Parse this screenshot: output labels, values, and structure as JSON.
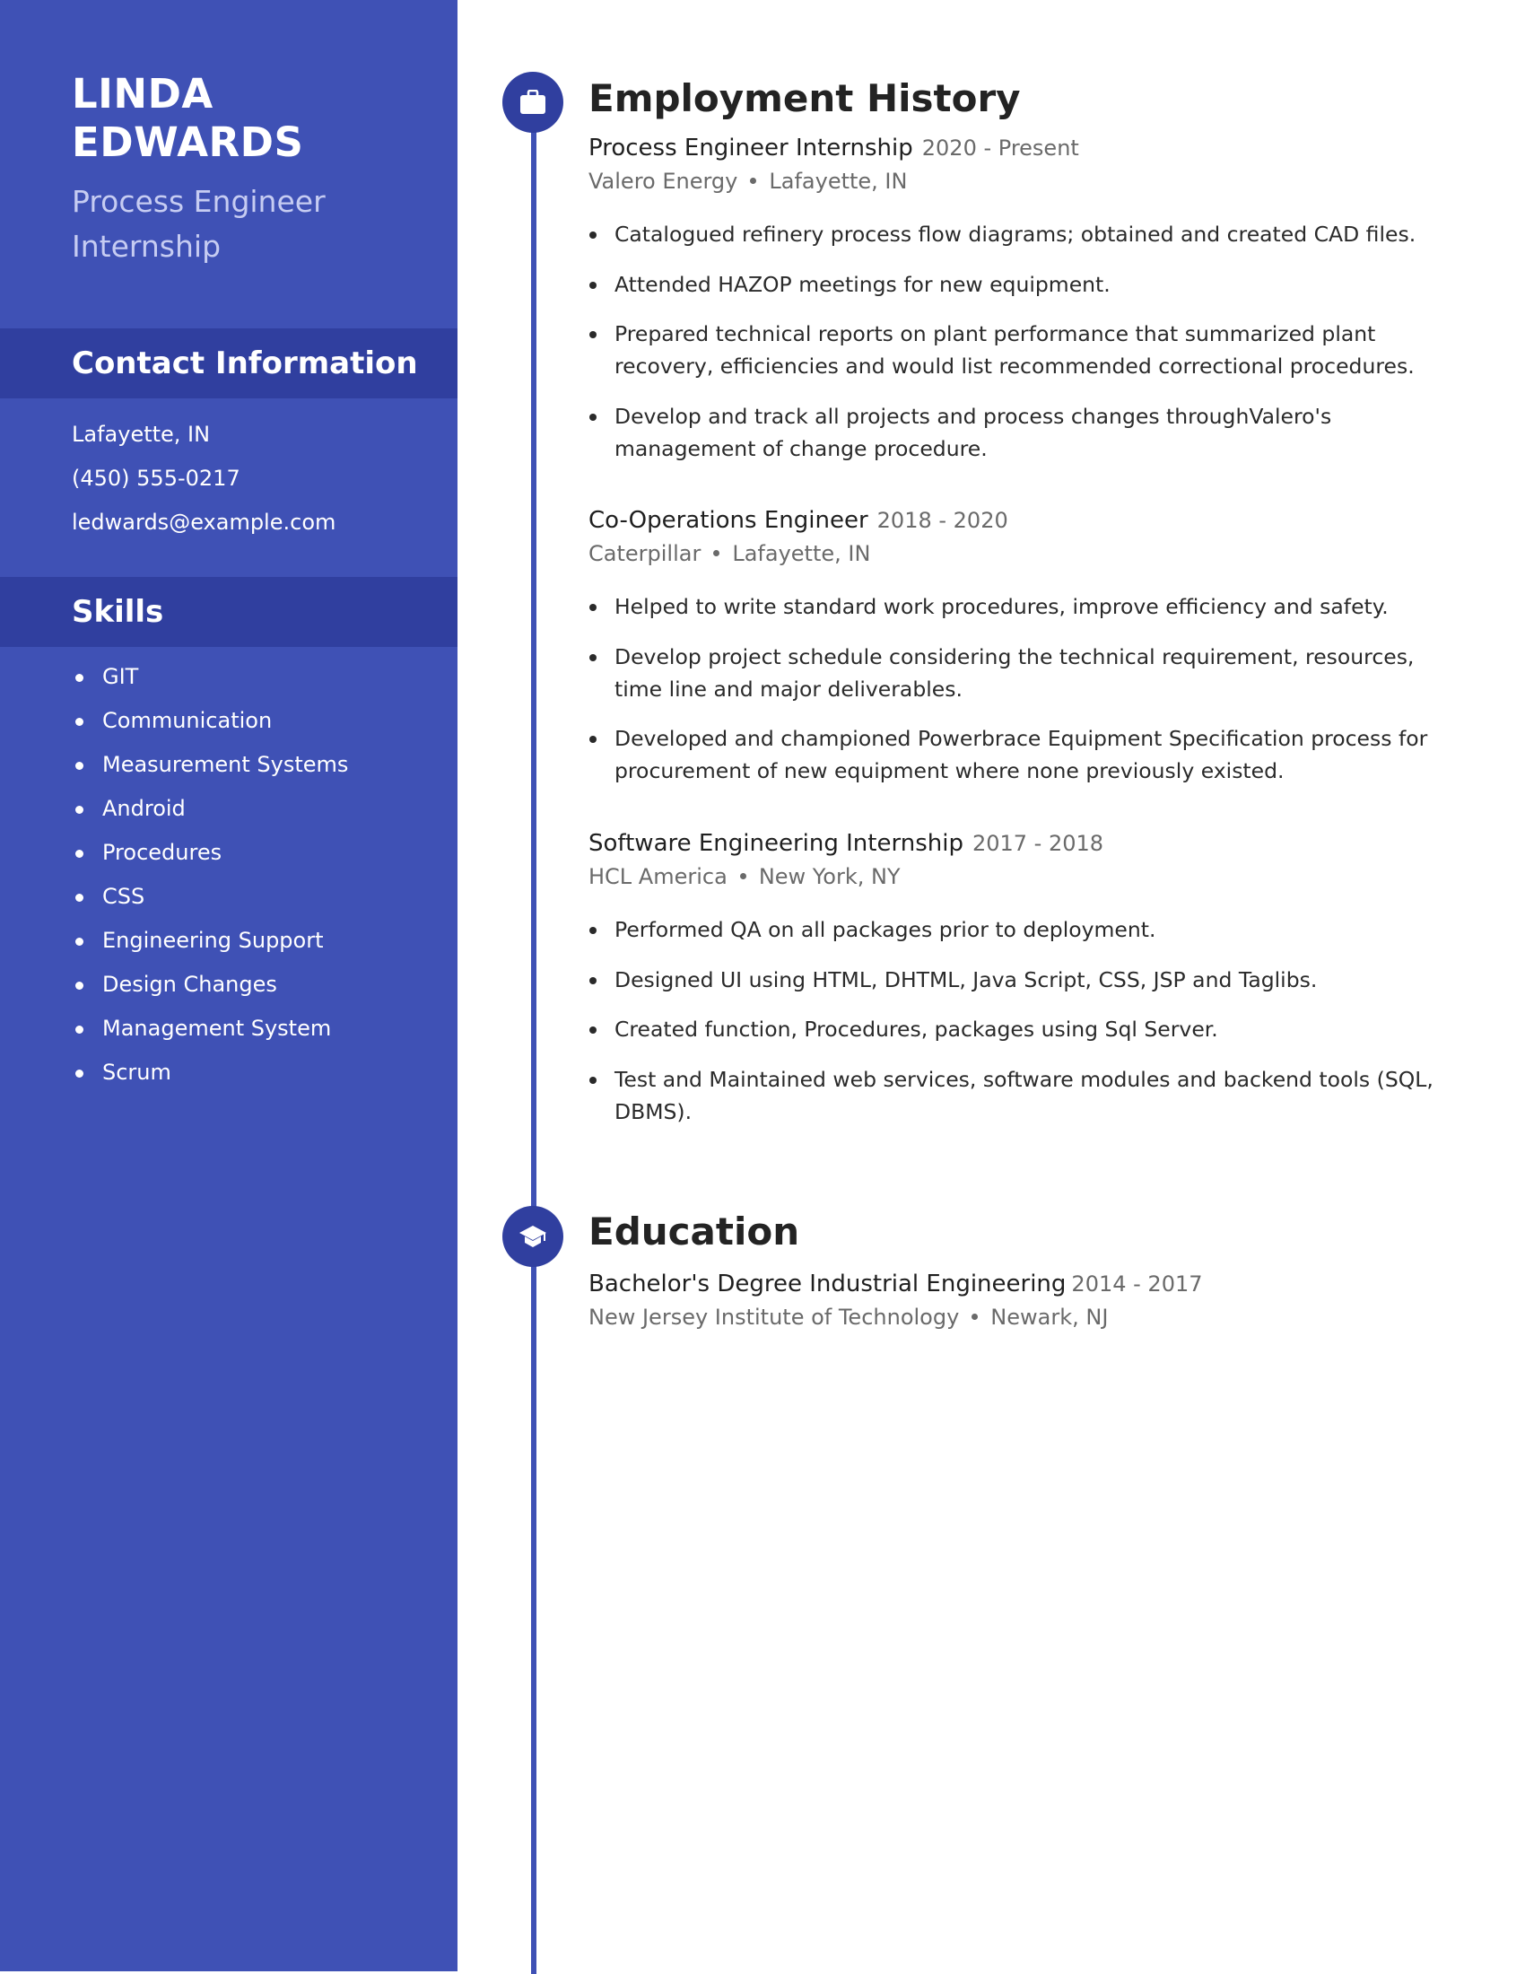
{
  "profile": {
    "first_name": "LINDA",
    "last_name": "EDWARDS",
    "headline_line1": "Process Engineer",
    "headline_line2": "Internship"
  },
  "contact": {
    "section_title": "Contact Information",
    "items": [
      {
        "type": "location",
        "value": "Lafayette, IN"
      },
      {
        "type": "phone",
        "value": "(450) 555-0217"
      },
      {
        "type": "email",
        "value": "ledwards@example.com"
      }
    ]
  },
  "skills": {
    "section_title": "Skills",
    "items": [
      "GIT",
      "Communication",
      "Measurement Systems",
      "Android",
      "Procedures",
      "CSS",
      "Engineering Support",
      "Design Changes",
      "Management System",
      "Scrum"
    ]
  },
  "employment": {
    "section_title": "Employment History",
    "icon": "briefcase-icon",
    "jobs": [
      {
        "title": "Process Engineer Internship",
        "dates": "2020 - Present",
        "company": "Valero Energy",
        "location": "Lafayette, IN",
        "bullets": [
          "Catalogued refinery process flow diagrams; obtained and created CAD files.",
          "Attended HAZOP meetings for new equipment.",
          "Prepared technical reports on plant performance that summarized plant recovery, efficiencies and would list recommended correctional procedures.",
          "Develop and track all projects and process changes throughValero's management of change procedure."
        ]
      },
      {
        "title": "Co-Operations Engineer",
        "dates": "2018 - 2020",
        "company": "Caterpillar",
        "location": "Lafayette, IN",
        "bullets": [
          "Helped to write standard work procedures, improve efficiency and safety.",
          "Develop project schedule considering the technical requirement, resources, time line and major deliverables.",
          "Developed and championed Powerbrace Equipment Specification process for procurement of new equipment where none previously existed."
        ]
      },
      {
        "title": "Software Engineering Internship",
        "dates": "2017 - 2018",
        "company": "HCL America",
        "location": "New York, NY",
        "bullets": [
          "Performed QA on all packages prior to deployment.",
          "Designed UI using HTML, DHTML, Java Script, CSS, JSP and Taglibs.",
          "Created function, Procedures, packages using Sql Server.",
          "Test and Maintained web services, software modules and backend tools (SQL, DBMS)."
        ]
      }
    ]
  },
  "education": {
    "section_title": "Education",
    "icon": "graduation-cap-icon",
    "entries": [
      {
        "degree": "Bachelor's Degree Industrial Engineering",
        "dates": "2014 - 2017",
        "school": "New Jersey Institute of Technology",
        "location": "Newark, NJ"
      }
    ]
  },
  "colors": {
    "sidebar": "#3f51b5",
    "section_band": "#303f9f",
    "accent": "#3f51b5",
    "headline_text": "#c6ccf2",
    "body_text": "#2a2a2a",
    "muted_text": "#6a6a6a"
  }
}
